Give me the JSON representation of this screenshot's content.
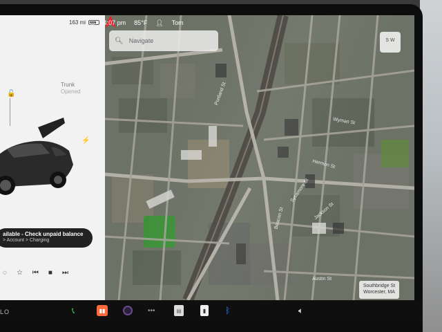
{
  "status_bar": {
    "range": "163 mi",
    "time": "4:07 pm",
    "temperature": "85°F",
    "profile": "Tom"
  },
  "car_panel": {
    "trunk_label": "Trunk",
    "trunk_state": "Opened",
    "notice_line1": "ailable - Check unpaid balance",
    "notice_line2": "> Account > Charging"
  },
  "map": {
    "search_placeholder": "Navigate",
    "compass_label": "S W",
    "location_line1": "Southbridge St",
    "location_line2": "Worcester, MA",
    "streets": [
      "Austin St",
      "Hermon St",
      "Sycamore St",
      "Wyman St",
      "Beacon St",
      "Jackson St",
      "Portland St"
    ]
  },
  "taskbar": {
    "car_label": "LO"
  },
  "colors": {
    "accent_green": "#2ecc55",
    "bluetooth_blue": "#2f7fff",
    "nav_arrow_red": "#e8232b"
  }
}
